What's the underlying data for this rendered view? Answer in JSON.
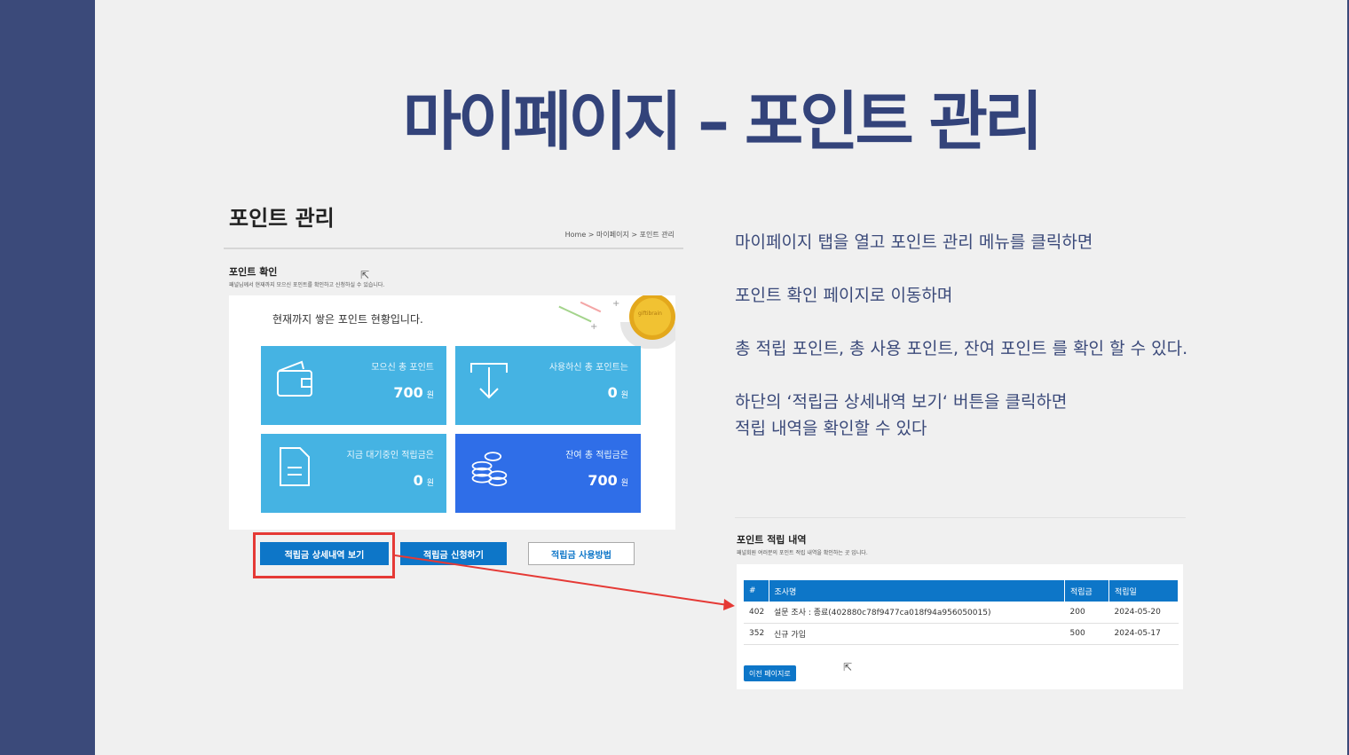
{
  "slide": {
    "title": "마이페이지 – 포인트 관리",
    "description": [
      "마이페이지 탭을 열고 포인트 관리 메뉴를 클릭하면",
      "포인트 확인 페이지로 이동하며",
      "총 적립 포인트, 총 사용 포인트, 잔여 포인트 를 확인 할 수 있다.",
      "하단의 ‘적립금 상세내역 보기‘ 버튼을 클릭하면",
      "적립 내역을 확인할 수 있다"
    ]
  },
  "colors": {
    "sidebar": "#3b4a7a",
    "title": "#33437a",
    "card": "#45b3e3",
    "card_accent": "#2f6ee8",
    "primary": "#0d76c8",
    "highlight": "#e53935"
  },
  "point_page": {
    "title": "포인트 관리",
    "breadcrumb": "Home > 마이페이지 > 포인트 관리",
    "section_title": "포인트 확인",
    "section_desc": "패널님께서 현재까지 모으신 포인트를 확인하고 신청하실 수 있습니다.",
    "intro": "현재까지 쌓은 포인트 현황입니다.",
    "coin_text": "giftibrain",
    "unit": "원",
    "cards": [
      {
        "label": "모으신 총 포인트",
        "value": "700",
        "icon": "wallet-icon"
      },
      {
        "label": "사용하신 총 포인트는",
        "value": "0",
        "icon": "download-arrow-icon"
      },
      {
        "label": "지금 대기중인 적립금은",
        "value": "0",
        "icon": "document-icon"
      },
      {
        "label": "잔여 총 적립금은",
        "value": "700",
        "icon": "coins-icon"
      }
    ],
    "buttons": {
      "detail": "적립금 상세내역 보기",
      "apply": "적립금 신청하기",
      "howto": "적립금 사용방법"
    }
  },
  "history_page": {
    "title": "포인트 적립 내역",
    "desc": "패널회원 여러분의 포인트 적립 내역을 확인하는 곳 입니다.",
    "columns": [
      "#",
      "조사명",
      "적립금",
      "적립일"
    ],
    "rows": [
      [
        "402",
        "설문 조사 : 종료(402880c78f9477ca018f94a956050015)",
        "200",
        "2024-05-20"
      ],
      [
        "352",
        "신규 가입",
        "500",
        "2024-05-17"
      ]
    ],
    "prev_button": "이전 페이지로"
  }
}
